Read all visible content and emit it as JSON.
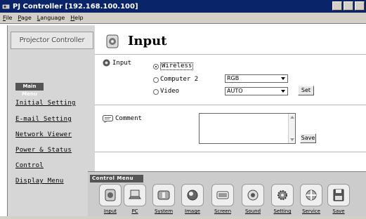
{
  "window": {
    "title": "PJ Controller [192.168.100.100]"
  },
  "menubar": {
    "items": [
      "File",
      "Page",
      "Language",
      "Help"
    ]
  },
  "sidebar": {
    "logo_text": "Projector Controller",
    "section_label": "Main Menu",
    "links": [
      "Initial Setting",
      "E-mail Setting",
      "Network Viewer",
      "Power & Status",
      "Control",
      "Display Menu"
    ]
  },
  "page": {
    "title": "Input",
    "input_label": "Input",
    "options": [
      {
        "label": "Wireless",
        "selected": true
      },
      {
        "label": "Computer 2",
        "selected": false,
        "dropdown": "RGB"
      },
      {
        "label": "Video",
        "selected": false,
        "dropdown": "AUTO"
      }
    ],
    "set_button": "Set",
    "comment_label": "Comment",
    "comment_value": "",
    "save_button": "Save"
  },
  "control_menu": {
    "label": "Control Menu",
    "items": [
      "Input",
      "PC",
      "System",
      "Image",
      "Screen",
      "Sound",
      "Setting",
      "Service",
      "Save"
    ]
  },
  "icons": {
    "app": "projector-icon",
    "header": "input-plug-icon",
    "input_label": "input-plug-icon",
    "comment": "comment-bubble-icon",
    "tools": [
      "input-plug-icon",
      "laptop-icon",
      "system-icon",
      "image-icon",
      "screen-icon",
      "sound-icon",
      "setting-icon",
      "service-icon",
      "save-disk-icon"
    ]
  },
  "colors": {
    "titlebar": "#0a246a",
    "sidebar": "#d6d6d6",
    "control_bar": "#cccccc",
    "badge": "#555555"
  }
}
